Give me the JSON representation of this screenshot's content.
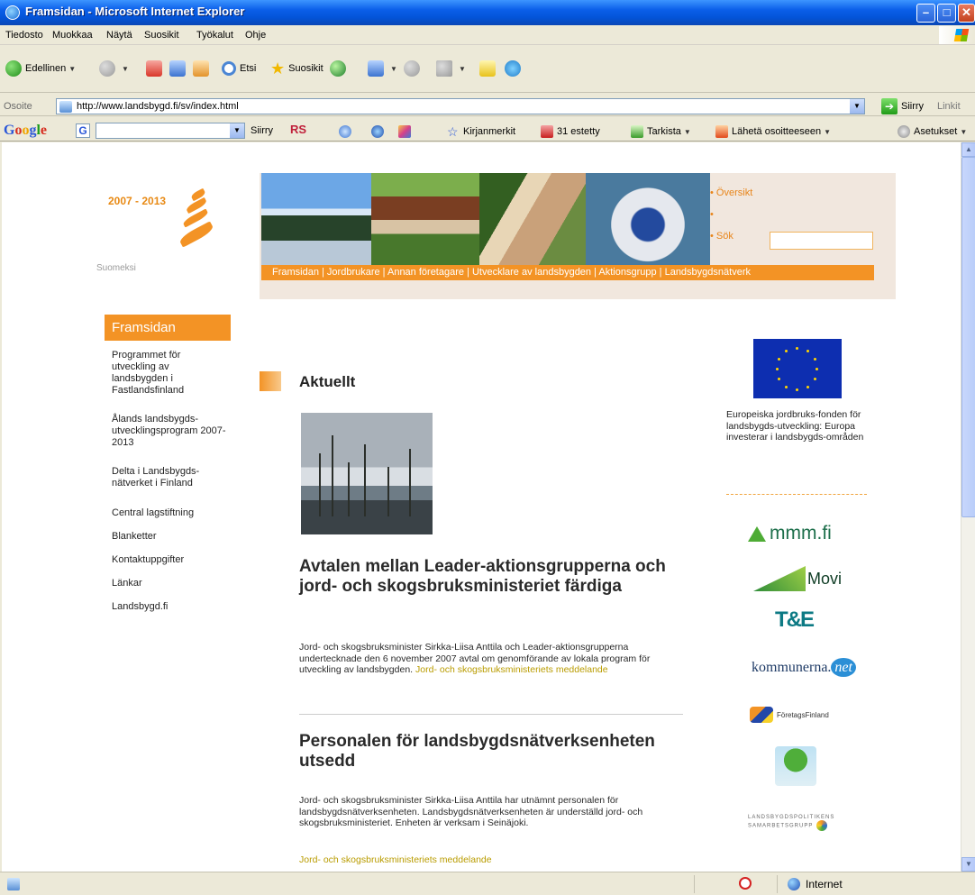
{
  "window": {
    "title": "Framsidan - Microsoft Internet Explorer"
  },
  "menu": [
    "Tiedosto",
    "Muokkaa",
    "Näytä",
    "Suosikit",
    "Työkalut",
    "Ohje"
  ],
  "toolbar": {
    "back": "Edellinen",
    "search": "Etsi",
    "favorites": "Suosikit"
  },
  "address": {
    "label": "Osoite",
    "url": "http://www.landsbygd.fi/sv/index.html",
    "go": "Siirry",
    "links": "Linkit"
  },
  "google": {
    "logo": [
      "G",
      "o",
      "o",
      "g",
      "l",
      "e"
    ],
    "go": "Siirry",
    "rs": "RS",
    "bookmarks": "Kirjanmerkit",
    "blocked": "31 estetty",
    "check": "Tarkista",
    "send": "Lähetä osoitteeseen",
    "settings": "Asetukset"
  },
  "site": {
    "years": "2007 - 2013",
    "lang": "Suomeksi",
    "topnav": [
      "Översikt",
      "",
      "Sök"
    ],
    "mainnav": "Framsidan | Jordbrukare | Annan företagare | Utvecklare av landsbygden | Aktionsgrupp | Landsbygdsnätverk",
    "sidenav": {
      "head": "Framsidan",
      "items": [
        "Programmet för utveckling av landsbygden i Fastlandsfinland",
        "Ålands landsbygds-utvecklingsprogram 2007-2013",
        "Delta i Landsbygds-nätverket i Finland",
        "Central lagstiftning",
        "Blanketter",
        "Kontaktuppgifter",
        "Länkar",
        "Landsbygd.fi"
      ]
    },
    "main": {
      "heading": "Aktuellt",
      "article1": {
        "title": "Avtalen mellan Leader-aktionsgrupperna och jord- och skogsbruksministeriet färdiga",
        "body": "Jord- och skogsbruksminister Sirkka-Liisa Anttila och Leader-aktionsgrupperna undertecknade den 6 november 2007 avtal om genomförande av lokala program för utveckling av landsbygden.",
        "link": "Jord- och skogsbruksministeriets meddelande"
      },
      "article2": {
        "title": "Personalen för landsbygdsnätverksenheten utsedd",
        "body": "Jord- och skogsbruksminister Sirkka-Liisa Anttila har utnämnt personalen för landsbygdsnätverksenheten. Landsbygdsnätverksenheten är underställd jord- och skogsbruksministeriet. Enheten är verksam i Seinäjoki.",
        "link": "Jord- och skogsbruksministeriets meddelande"
      }
    },
    "right": {
      "eu_text": "Europeiska jordbruks-fonden för landsbygds-utveckling: Europa investerar i landsbygds-områden",
      "logos": {
        "mmm": "mmm.fi",
        "movi": "Movi",
        "te": "T&E",
        "kommunerna_a": "kommunerna.",
        "kommunerna_b": "net",
        "foretag": "FöretagsFinland",
        "lsp": "LANDSBYGDSPOLITIKENS SAMARBETSGRUPP"
      }
    }
  },
  "status": {
    "zone": "Internet"
  }
}
